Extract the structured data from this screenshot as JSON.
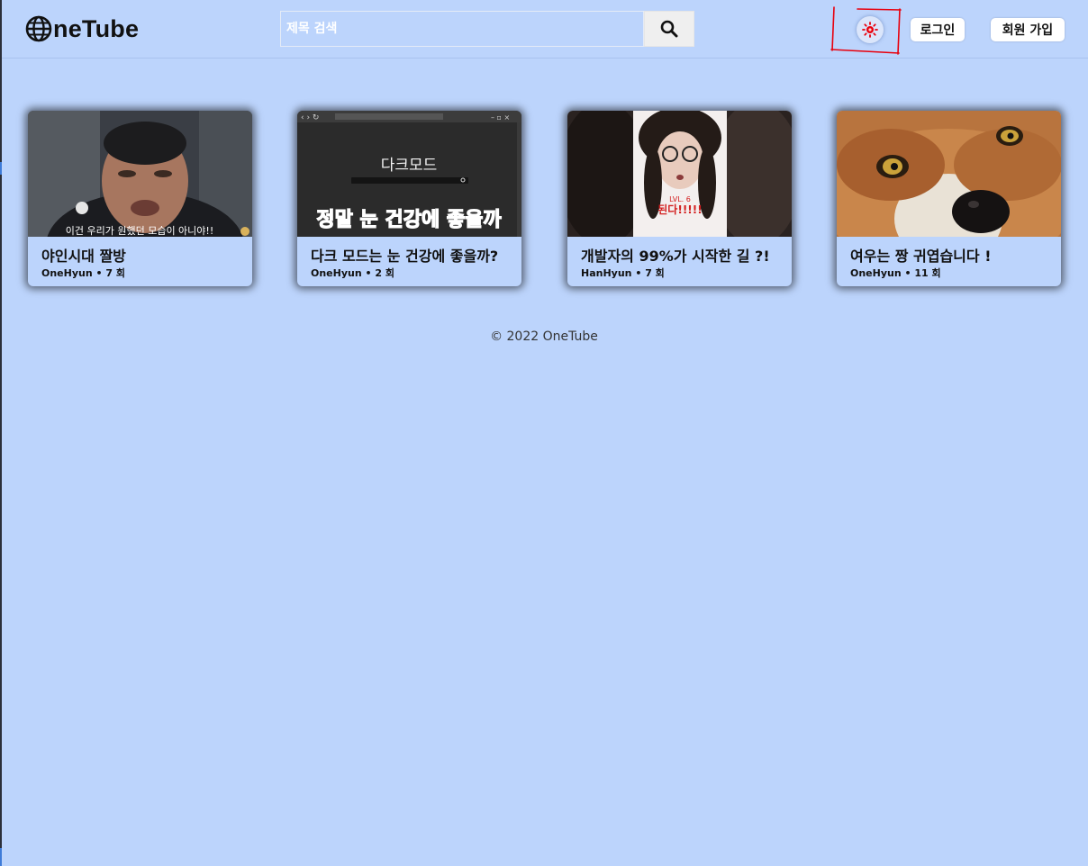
{
  "header": {
    "logo_text": "neTube",
    "search": {
      "placeholder": "제목 검색",
      "value": ""
    },
    "login_label": "로그인",
    "signup_label": "회원 가입"
  },
  "colors": {
    "background": "#bcd4fc",
    "theme_icon": "#e8000d",
    "annotation": "#e8000d"
  },
  "icons": {
    "logo": "globe-icon",
    "search": "magnifier-icon",
    "theme": "sun-icon"
  },
  "videos": [
    {
      "title": "야인시대 짤방",
      "meta": "OneHyun • 7 회",
      "caption": "이건 우리가 원했던 모습이 아니야!!"
    },
    {
      "title": "다크 모드는 눈 건강에 좋을까?",
      "meta": "OneHyun • 2 회",
      "overlay_title": "다크모드",
      "overlay_text": "정말 눈 건강에 좋을까"
    },
    {
      "title": "개발자의 99%가 시작한 길 ?!",
      "meta": "HanHyun • 7 회",
      "overlay_small": "LVL. 6",
      "overlay_text": "된다!!!!!"
    },
    {
      "title": "여우는 짱 귀엽습니다 !",
      "meta": "OneHyun • 11 회"
    }
  ],
  "footer": {
    "text": "© 2022 OneTube"
  }
}
